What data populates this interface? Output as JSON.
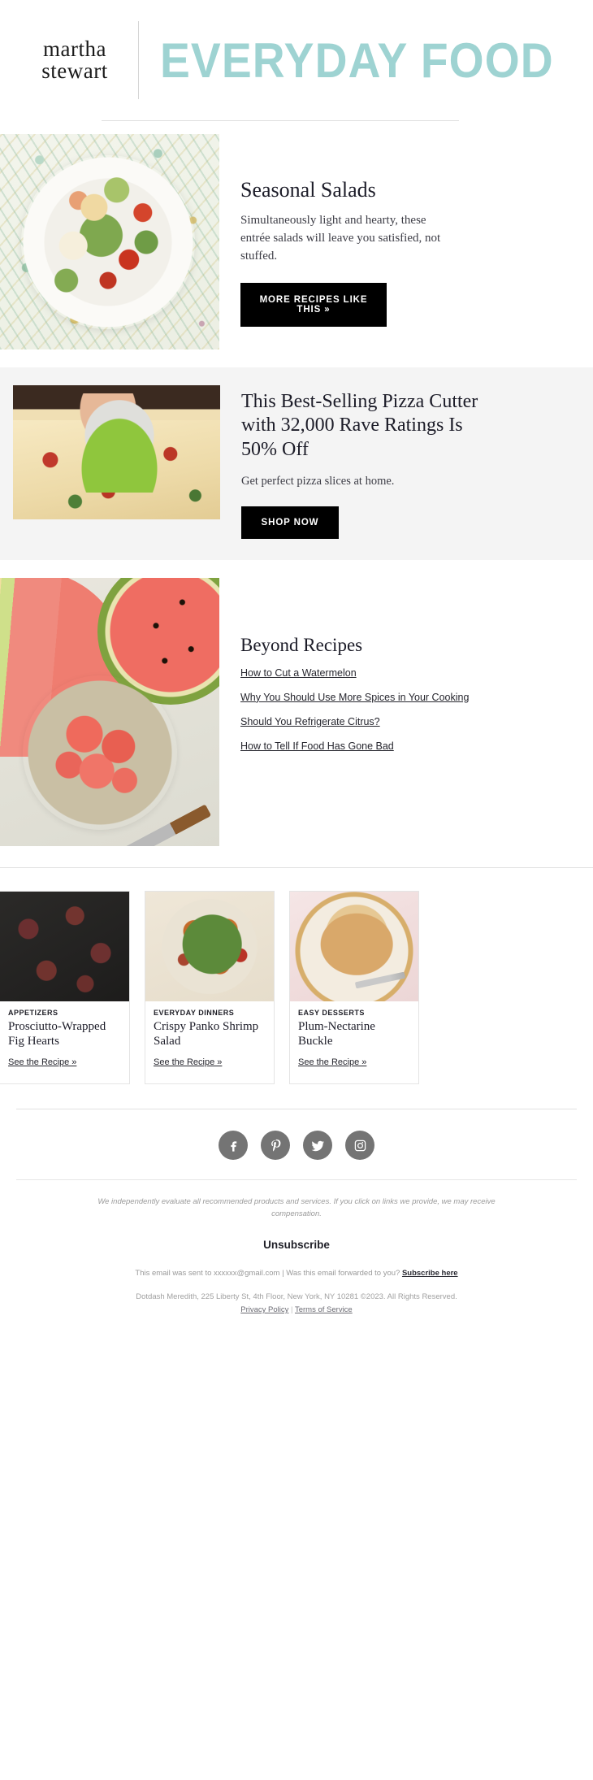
{
  "header": {
    "logo_line1": "martha",
    "logo_line2": "stewart",
    "masthead": "EVERYDAY FOOD",
    "masthead_color": "#9ed3d2"
  },
  "salads": {
    "title": "Seasonal Salads",
    "description": "Simultaneously light and hearty, these entrée salads will leave you satisfied, not stuffed.",
    "cta_label": "MORE RECIPES LIKE THIS »",
    "image_alt": "seasonal-salad-photo"
  },
  "promo": {
    "title": "This Best-Selling Pizza Cutter with 32,000 Rave Ratings Is 50% Off",
    "description": "Get perfect pizza slices at home.",
    "cta_label": "SHOP NOW",
    "image_alt": "pizza-cutter-photo",
    "background_color": "#f4f4f4"
  },
  "beyond": {
    "title": "Beyond Recipes",
    "image_alt": "watermelon-photo",
    "links": [
      "How to Cut a Watermelon",
      "Why You Should Use More Spices in Your Cooking",
      "Should You Refrigerate Citrus?",
      "How to Tell If Food Has Gone Bad"
    ]
  },
  "cards": [
    {
      "kicker": "APPETIZERS",
      "title": "Prosciutto-Wrapped Fig Hearts",
      "link": "See the Recipe »",
      "image_alt": "prosciutto-wrapped-fig-hearts-photo"
    },
    {
      "kicker": "EVERYDAY DINNERS",
      "title": "Crispy Panko Shrimp Salad",
      "link": "See the Recipe »",
      "image_alt": "crispy-panko-shrimp-salad-photo"
    },
    {
      "kicker": "EASY DESSERTS",
      "title": "Plum-Nectarine Buckle",
      "link": "See the Recipe »",
      "image_alt": "plum-nectarine-buckle-photo"
    }
  ],
  "social": {
    "icon_color": "#747474",
    "items": [
      {
        "name": "facebook-icon",
        "label": "Facebook"
      },
      {
        "name": "pinterest-icon",
        "label": "Pinterest"
      },
      {
        "name": "twitter-icon",
        "label": "Twitter"
      },
      {
        "name": "instagram-icon",
        "label": "Instagram"
      }
    ]
  },
  "footer": {
    "disclaimer": "We independently evaluate all recommended products and services. If you click on links we provide, we may receive compensation.",
    "unsubscribe_label": "Unsubscribe",
    "sent_to_prefix": "This email was sent to xxxxxx@gmail.com",
    "separator": "|",
    "forwarded_question": "Was this email forwarded to you?",
    "subscribe_label": "Subscribe here",
    "copyright": "Dotdash Meredith, 225 Liberty St, 4th Floor, New York, NY 10281 ©2023. All Rights Reserved.",
    "privacy_label": "Privacy Policy",
    "legal_separator": "|",
    "terms_label": "Terms of Service"
  }
}
